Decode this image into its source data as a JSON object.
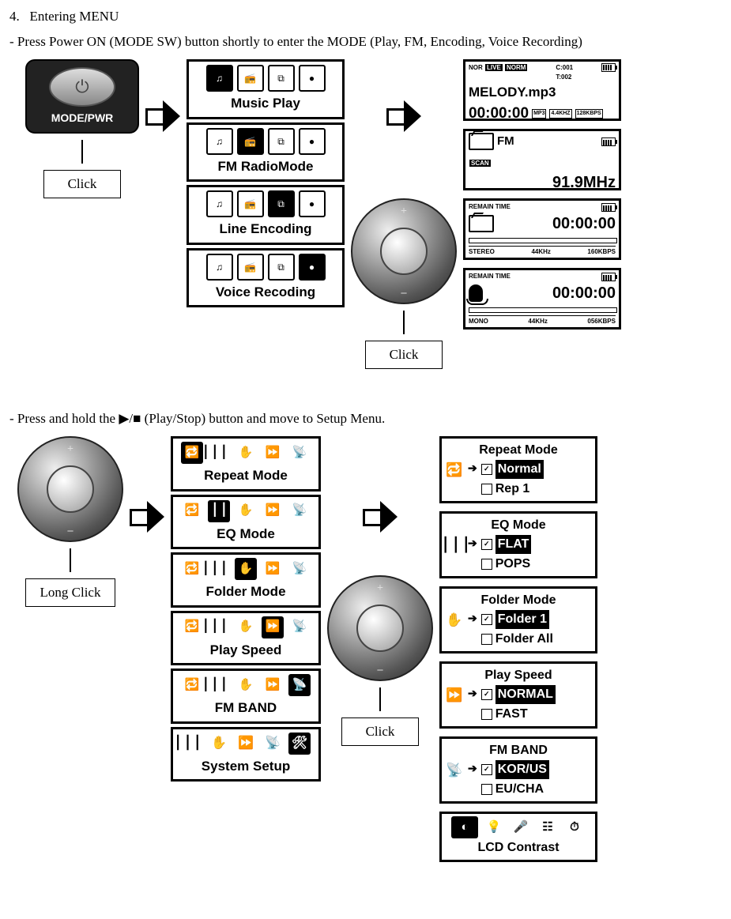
{
  "section": {
    "number": "4.",
    "title": "Entering MENU",
    "line1": "- Press Power ON (MODE SW) button shortly to enter the MODE (Play, FM, Encoding, Voice Recording)",
    "line2": "- Press and hold the ▶/■ (Play/Stop) button and move to Setup Menu."
  },
  "buttons": {
    "mode_pwr_label": "MODE/PWR",
    "click": "Click",
    "long_click": "Long Click"
  },
  "mode_menu": [
    {
      "label": "Music Play"
    },
    {
      "label": "FM RadioMode"
    },
    {
      "label": "Line Encoding"
    },
    {
      "label": "Voice Recoding"
    }
  ],
  "mode_screens": {
    "play": {
      "nor": "NOR",
      "live": "LIVE",
      "norm": "NORM",
      "counter_c": "C:001",
      "counter_t": "T:002",
      "filename": "MELODY.mp3",
      "time": "00:00:00",
      "mp3": "MP3",
      "khz": "4.4KHZ",
      "kbps": "128KBPS"
    },
    "fm": {
      "label": "FM",
      "scan": "SCAN",
      "freq": "91.9MHz"
    },
    "line": {
      "remain": "REMAIN TIME",
      "time": "00:00:00",
      "stereo": "STEREO",
      "khz": "44KHz",
      "kbps": "160KBPS"
    },
    "voice": {
      "remain": "REMAIN TIME",
      "time": "00:00:00",
      "mono": "MONO",
      "khz": "44KHz",
      "kbps": "056KBPS"
    }
  },
  "setup_menu": [
    {
      "label": "Repeat Mode"
    },
    {
      "label": "EQ Mode"
    },
    {
      "label": "Folder Mode"
    },
    {
      "label": "Play Speed"
    },
    {
      "label": "FM BAND"
    },
    {
      "label": "System Setup"
    }
  ],
  "setup_screens": {
    "repeat": {
      "title": "Repeat Mode",
      "sel": "Normal",
      "opt": "Rep 1"
    },
    "eq": {
      "title": "EQ Mode",
      "sel": "FLAT",
      "opt": "POPS"
    },
    "folder": {
      "title": "Folder Mode",
      "sel": "Folder 1",
      "opt": "Folder All"
    },
    "speed": {
      "title": "Play Speed",
      "sel": "NORMAL",
      "opt": "FAST"
    },
    "fmband": {
      "title": "FM BAND",
      "sel": "KOR/US",
      "opt": "EU/CHA"
    },
    "system": {
      "title": "LCD Contrast"
    }
  }
}
